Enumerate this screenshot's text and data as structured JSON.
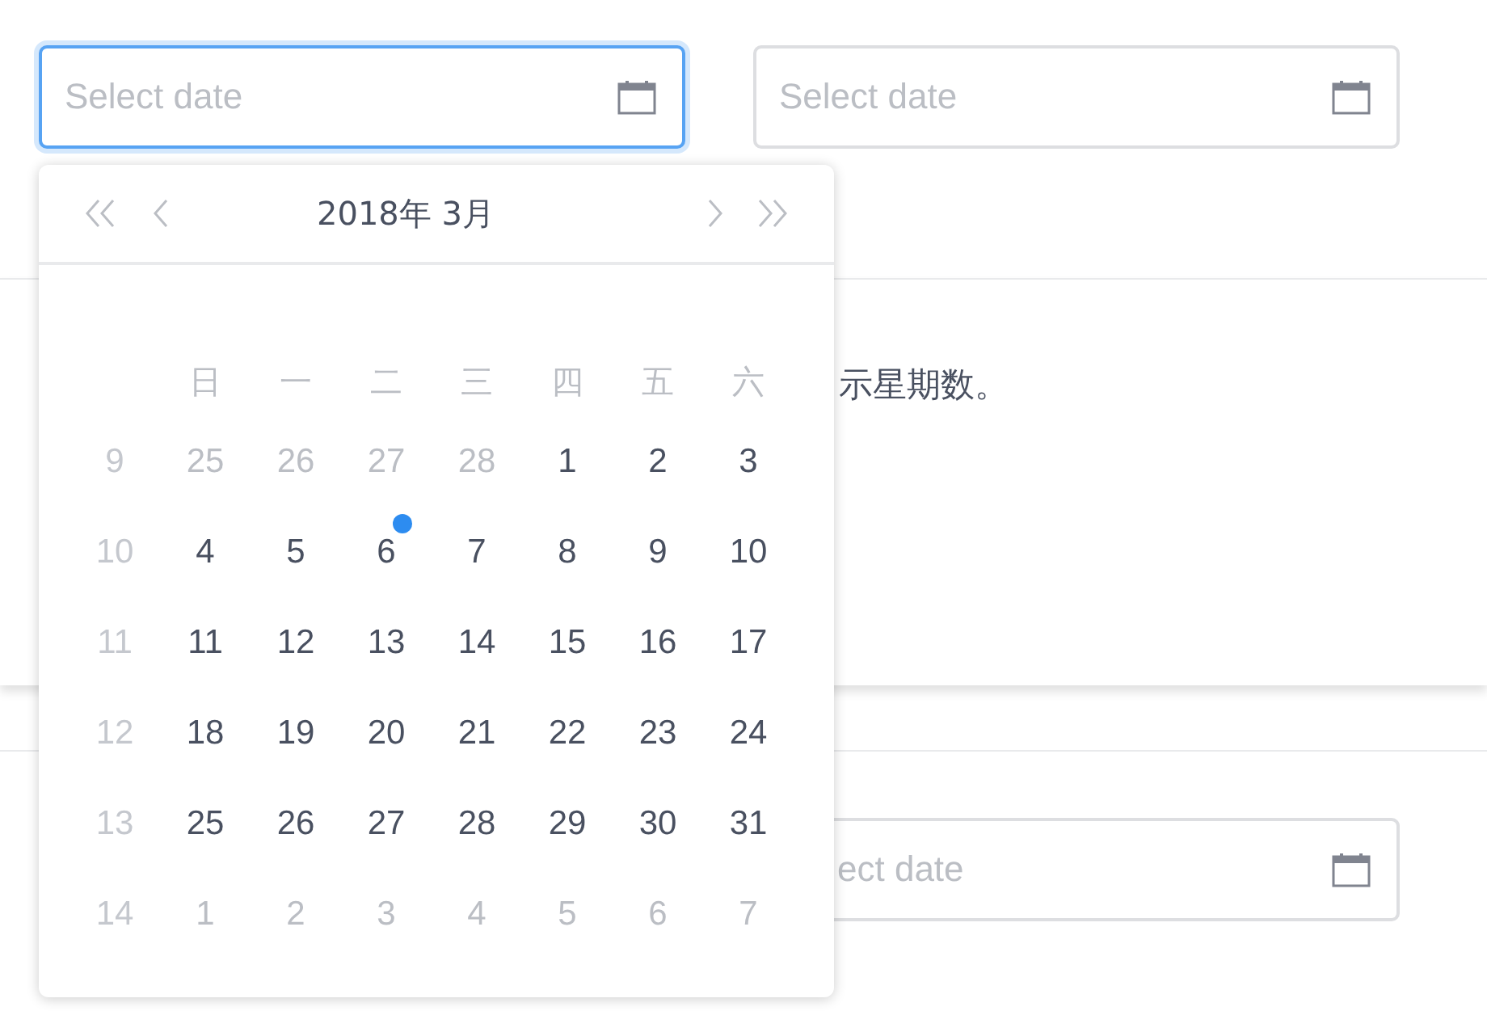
{
  "fields": [
    {
      "placeholder": "Select date",
      "focused": true
    },
    {
      "placeholder": "Select date",
      "focused": false
    }
  ],
  "description": "示星期数。",
  "bottom_field": {
    "placeholder": "ect date"
  },
  "calendar": {
    "title": "2018年 3月",
    "weekdays": [
      "日",
      "一",
      "二",
      "三",
      "四",
      "五",
      "六"
    ],
    "weeks": [
      {
        "week": "9",
        "days": [
          {
            "label": "25",
            "outside": true
          },
          {
            "label": "26",
            "outside": true
          },
          {
            "label": "27",
            "outside": true
          },
          {
            "label": "28",
            "outside": true
          },
          {
            "label": "1",
            "outside": false
          },
          {
            "label": "2",
            "outside": false
          },
          {
            "label": "3",
            "outside": false
          }
        ]
      },
      {
        "week": "10",
        "days": [
          {
            "label": "4",
            "outside": false
          },
          {
            "label": "5",
            "outside": false
          },
          {
            "label": "6",
            "outside": false,
            "today": true
          },
          {
            "label": "7",
            "outside": false
          },
          {
            "label": "8",
            "outside": false
          },
          {
            "label": "9",
            "outside": false
          },
          {
            "label": "10",
            "outside": false
          }
        ]
      },
      {
        "week": "11",
        "days": [
          {
            "label": "11",
            "outside": false
          },
          {
            "label": "12",
            "outside": false
          },
          {
            "label": "13",
            "outside": false
          },
          {
            "label": "14",
            "outside": false
          },
          {
            "label": "15",
            "outside": false
          },
          {
            "label": "16",
            "outside": false
          },
          {
            "label": "17",
            "outside": false
          }
        ]
      },
      {
        "week": "12",
        "days": [
          {
            "label": "18",
            "outside": false
          },
          {
            "label": "19",
            "outside": false
          },
          {
            "label": "20",
            "outside": false
          },
          {
            "label": "21",
            "outside": false
          },
          {
            "label": "22",
            "outside": false
          },
          {
            "label": "23",
            "outside": false
          },
          {
            "label": "24",
            "outside": false
          }
        ]
      },
      {
        "week": "13",
        "days": [
          {
            "label": "25",
            "outside": false
          },
          {
            "label": "26",
            "outside": false
          },
          {
            "label": "27",
            "outside": false
          },
          {
            "label": "28",
            "outside": false
          },
          {
            "label": "29",
            "outside": false
          },
          {
            "label": "30",
            "outside": false
          },
          {
            "label": "31",
            "outside": false
          }
        ]
      },
      {
        "week": "14",
        "days": [
          {
            "label": "1",
            "outside": true
          },
          {
            "label": "2",
            "outside": true
          },
          {
            "label": "3",
            "outside": true
          },
          {
            "label": "4",
            "outside": true
          },
          {
            "label": "5",
            "outside": true
          },
          {
            "label": "6",
            "outside": true
          },
          {
            "label": "7",
            "outside": true
          }
        ]
      }
    ]
  }
}
